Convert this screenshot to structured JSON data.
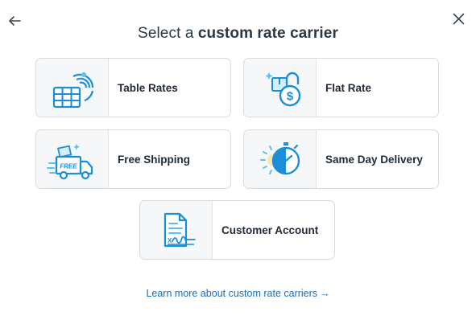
{
  "header": {
    "title_prefix": "Select a ",
    "title_bold": "custom rate carrier"
  },
  "cards": [
    {
      "label": "Table Rates",
      "icon": "table-rates-icon"
    },
    {
      "label": "Flat Rate",
      "icon": "flat-rate-lock-icon"
    },
    {
      "label": "Free Shipping",
      "icon": "free-shipping-truck-icon",
      "icon_text": "FREE"
    },
    {
      "label": "Same Day Delivery",
      "icon": "stopwatch-icon"
    },
    {
      "label": "Customer Account",
      "icon": "signed-document-icon",
      "icon_text": "X"
    }
  ],
  "footer": {
    "learn_more": "Learn more about custom rate carriers",
    "arrow": "→"
  },
  "colors": {
    "icon_blue": "#1a8fd8",
    "icon_light": "#5bc0ef",
    "link": "#1a6bb8"
  }
}
